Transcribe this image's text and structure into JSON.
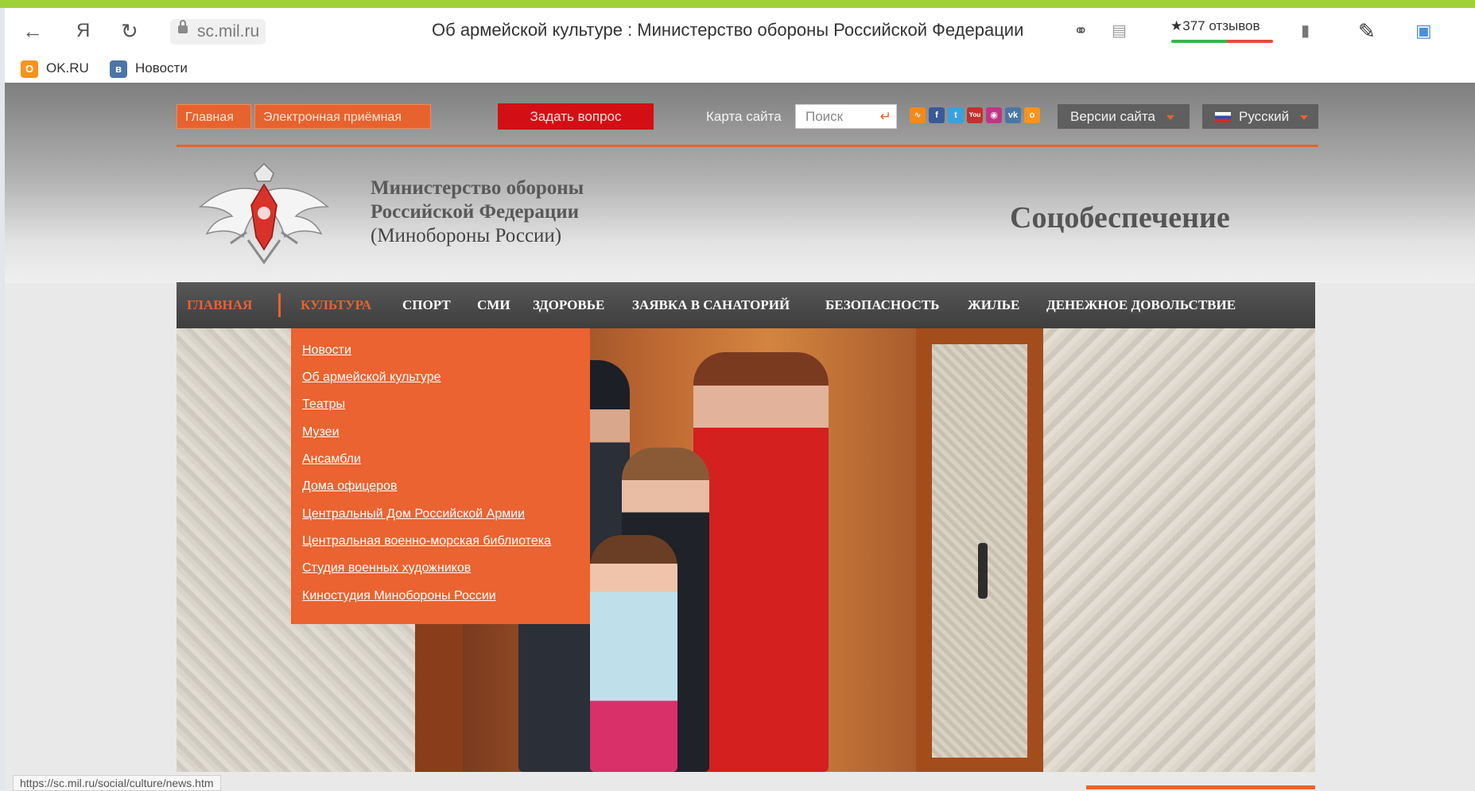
{
  "browser": {
    "url": "sc.mil.ru",
    "tab_title": "Об армейской культуре : Министерство обороны Российской Федерации",
    "reviews": "★377 отзывов",
    "status_url": "https://sc.mil.ru/social/culture/news.htm",
    "yandex_glyph": "Я"
  },
  "bookmarks": [
    {
      "label": "OK.RU",
      "icon": "ok-icon",
      "color": "#f7931e"
    },
    {
      "label": "Новости",
      "icon": "vk-icon",
      "color": "#4a76a8"
    }
  ],
  "topbar": {
    "home": "Главная",
    "reception": "Электронная приёмная",
    "ask": "Задать вопрос",
    "sitemap": "Карта сайта",
    "search_placeholder": "Поиск",
    "versions": "Версии сайта",
    "language": "Русский"
  },
  "header": {
    "org_line1": "Министерство обороны",
    "org_line2": "Российской Федерации",
    "org_line3": "(Минобороны России)",
    "section": "Соцобеспечение"
  },
  "nav": [
    {
      "label": "ГЛАВНАЯ",
      "active": false
    },
    {
      "label": "КУЛЬТУРА",
      "active": true
    },
    {
      "label": "СПОРТ",
      "active": false
    },
    {
      "label": "СМИ",
      "active": false
    },
    {
      "label": "ЗДОРОВЬЕ",
      "active": false
    },
    {
      "label": "ЗАЯВКА В САНАТОРИЙ",
      "active": false
    },
    {
      "label": "БЕЗОПАСНОСТЬ",
      "active": false
    },
    {
      "label": "ЖИЛЬЕ",
      "active": false
    },
    {
      "label": "ДЕНЕЖНОЕ ДОВОЛЬСТВИЕ",
      "active": false
    }
  ],
  "culture_menu": [
    "Новости",
    "Об армейской культуре",
    "Театры",
    "Музеи",
    "Ансамбли",
    "Дома офицеров",
    "Центральный Дом Российской Армии",
    "Центральная военно-морская библиотека",
    "Студия военных художников",
    "Киностудия Минобороны России"
  ],
  "colors": {
    "accent": "#e8622e",
    "ask_button": "#d30f15",
    "nav_bg": "#4a4a4a"
  }
}
